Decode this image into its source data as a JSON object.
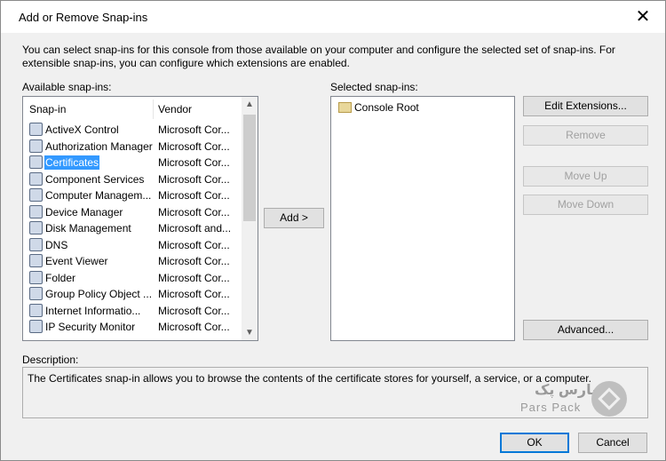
{
  "window": {
    "title": "Add or Remove Snap-ins",
    "close_glyph": "✕"
  },
  "intro_text": "You can select snap-ins for this console from those available on your computer and configure the selected set of snap-ins. For extensible snap-ins, you can configure which extensions are enabled.",
  "available": {
    "label": "Available snap-ins:",
    "columns": [
      "Snap-in",
      "Vendor"
    ],
    "rows": [
      {
        "name": "ActiveX Control",
        "vendor": "Microsoft Cor...",
        "icon": "activex-icon"
      },
      {
        "name": "Authorization Manager",
        "vendor": "Microsoft Cor...",
        "icon": "authorization-icon"
      },
      {
        "name": "Certificates",
        "vendor": "Microsoft Cor...",
        "icon": "certificates-icon",
        "selected": true
      },
      {
        "name": "Component Services",
        "vendor": "Microsoft Cor...",
        "icon": "component-services-icon"
      },
      {
        "name": "Computer Managem...",
        "vendor": "Microsoft Cor...",
        "icon": "computer-management-icon"
      },
      {
        "name": "Device Manager",
        "vendor": "Microsoft Cor...",
        "icon": "device-manager-icon"
      },
      {
        "name": "Disk Management",
        "vendor": "Microsoft and...",
        "icon": "disk-management-icon"
      },
      {
        "name": "DNS",
        "vendor": "Microsoft Cor...",
        "icon": "dns-icon"
      },
      {
        "name": "Event Viewer",
        "vendor": "Microsoft Cor...",
        "icon": "event-viewer-icon"
      },
      {
        "name": "Folder",
        "vendor": "Microsoft Cor...",
        "icon": "folder-icon"
      },
      {
        "name": "Group Policy Object ...",
        "vendor": "Microsoft Cor...",
        "icon": "group-policy-icon"
      },
      {
        "name": "Internet Informatio...",
        "vendor": "Microsoft Cor...",
        "icon": "iis-icon"
      },
      {
        "name": "IP Security Monitor",
        "vendor": "Microsoft Cor...",
        "icon": "ip-security-icon"
      }
    ]
  },
  "add_button": "Add >",
  "selected": {
    "label": "Selected snap-ins:",
    "items": [
      {
        "name": "Console Root",
        "icon": "folder-icon"
      }
    ]
  },
  "buttons": {
    "edit_extensions": "Edit Extensions...",
    "remove": "Remove",
    "move_up": "Move Up",
    "move_down": "Move Down",
    "advanced": "Advanced...",
    "ok": "OK",
    "cancel": "Cancel"
  },
  "description": {
    "label": "Description:",
    "text": "The Certificates snap-in allows you to browse the contents of the certificate stores for yourself, a service, or a computer."
  },
  "watermark": {
    "fa": "پارس پک",
    "en": "Pars Pack"
  },
  "colors": {
    "selection": "#3399ff",
    "dialog_bg": "#f0f0f0",
    "default_button_border": "#0078d7"
  }
}
